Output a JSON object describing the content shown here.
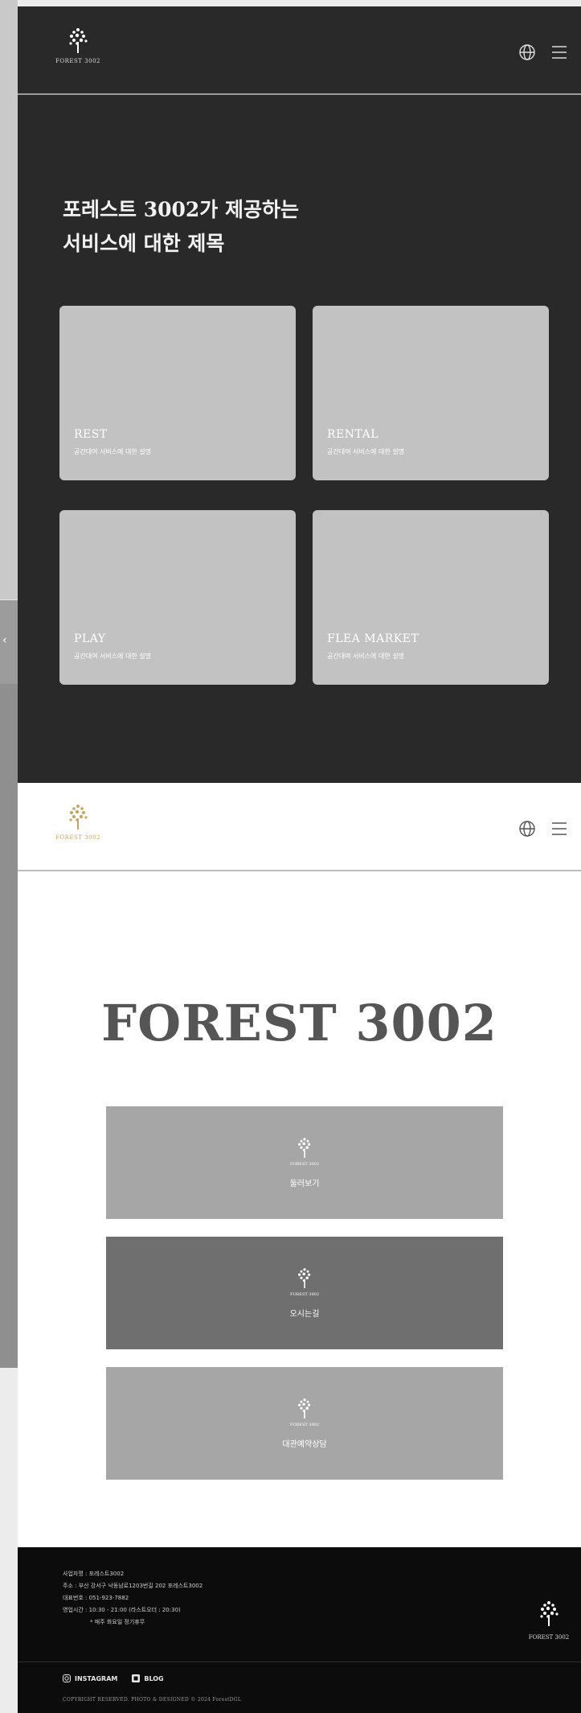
{
  "brand": {
    "logo_text": "FOREST 3002",
    "title": "FOREST 3002"
  },
  "dark_section": {
    "title_line1": "포레스트 3002가 제공하는",
    "title_line2": "서비스에 대한 제목",
    "cards": [
      {
        "title": "REST",
        "desc": "공간대여 서비스에 대한 설명"
      },
      {
        "title": "RENTAL",
        "desc": "공간대여 서비스에 대한 설명"
      },
      {
        "title": "PLAY",
        "desc": "공간대여 서비스에 대한 설명"
      },
      {
        "title": "FLEA MARKET",
        "desc": "공간대여 서비스에 대한 설명"
      }
    ]
  },
  "menu_blocks": [
    {
      "label": "둘러보기"
    },
    {
      "label": "오시는길"
    },
    {
      "label": "대관예약상담"
    }
  ],
  "footer": {
    "info": [
      "사업자명 : 포레스트3002",
      "주소 : 부산 강서구 낙동남로1203번길 202 포레스트3002",
      "대표번호 : 051-923-7882",
      "영업시간 : 10:30 - 21:00 (라스트오더 : 20:30)",
      "* 매주 화요일 정기휴무"
    ],
    "links": [
      {
        "label": "INSTAGRAM"
      },
      {
        "label": "BLOG"
      }
    ],
    "copyright": "COPYRIGHT RESERVED. PHOTO & DESIGNED © 2024 ForestDGL"
  },
  "icons": {
    "language": "globe-icon",
    "menu": "hamburger-icon"
  },
  "colors": {
    "dark_bg": "#292929",
    "card": "#c2c2c2",
    "gold": "#c9a35c",
    "footer_bg": "#0c0c0c"
  }
}
